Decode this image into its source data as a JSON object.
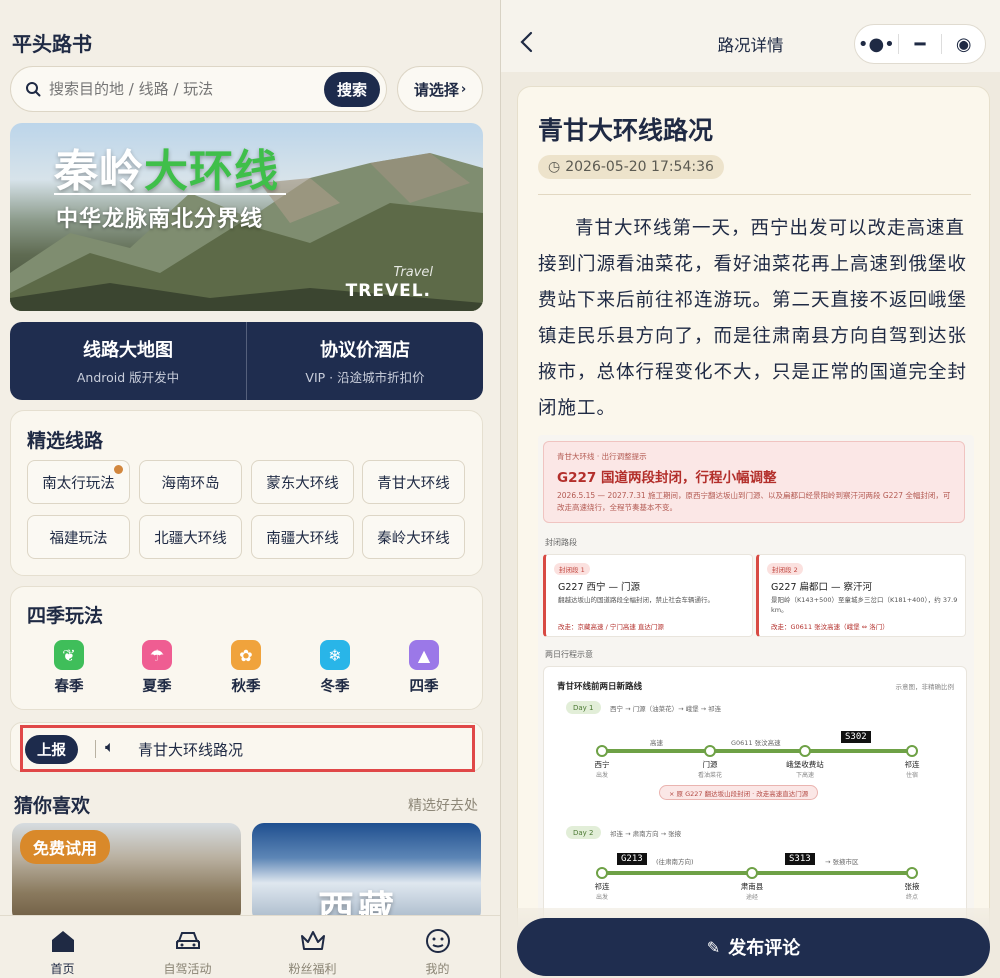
{
  "left": {
    "app_title": "平头路书",
    "search": {
      "placeholder": "搜索目的地 / 线路 / 玩法",
      "button": "搜索"
    },
    "select_label": "请选择",
    "banner": {
      "title_a": "秦岭",
      "title_b": "大环线",
      "subtitle": "中华龙脉南北分界线",
      "tag_script": "Travel",
      "tag_caps": "TREVEL."
    },
    "quick": [
      {
        "title": "线路大地图",
        "sub": "Android 版开发中"
      },
      {
        "title": "协议价酒店",
        "sub": "VIP · 沿途城市折扣价"
      }
    ],
    "routes_title": "精选线路",
    "routes": [
      "南太行玩法",
      "海南环岛",
      "蒙东大环线",
      "青甘大环线",
      "福建玩法",
      "北疆大环线",
      "南疆大环线",
      "秦岭大环线"
    ],
    "seasons_title": "四季玩法",
    "seasons": [
      {
        "label": "春季",
        "icon": "leaf-icon",
        "color": "#3fbe5a"
      },
      {
        "label": "夏季",
        "icon": "palm-icon",
        "color": "#ef5d92"
      },
      {
        "label": "秋季",
        "icon": "maple-icon",
        "color": "#f0a33c"
      },
      {
        "label": "冬季",
        "icon": "snowflake-icon",
        "color": "#29b5e8"
      },
      {
        "label": "四季",
        "icon": "mountain-icon",
        "color": "#9b78e8"
      }
    ],
    "announce": {
      "tag": "上报",
      "text": "青甘大环线路况"
    },
    "guess": {
      "title": "猜你喜欢",
      "more": "精选好去处",
      "badge": "免费试用",
      "card2_title": "西藏"
    },
    "tabs": [
      {
        "label": "首页",
        "icon": "home-icon"
      },
      {
        "label": "自驾活动",
        "icon": "car-icon"
      },
      {
        "label": "粉丝福利",
        "icon": "crown-icon"
      },
      {
        "label": "我的",
        "icon": "profile-icon"
      }
    ]
  },
  "right": {
    "nav_title": "路况详情",
    "article": {
      "title": "青甘大环线路况",
      "time": "2026-05-20 17:54:36",
      "body": "青甘大环线第一天，西宁出发可以改走高速直接到门源看油菜花，看好油菜花再上高速到俄堡收费站下来后前往祁连游玩。第二天直接不返回峨堡镇走民乐县方向了，而是往肃南县方向自驾到达张掖市，总体行程变化不大，只是正常的国道完全封闭施工。"
    },
    "doc": {
      "warn_small": "青甘大环线 · 出行调整提示",
      "warn_title": "G227 国道两段封闭，行程小幅调整",
      "warn_text": "2026.5.15 — 2027.7.31 施工期间，原西宁翻达坂山到门源、以及扁都口经景阳岭到察汗河两段 G227 全幅封闭，可改走高速绕行，全程节奏基本不变。",
      "closed_label": "封闭路段",
      "segments": [
        {
          "tag": "封闭段 1",
          "name": "G227 西宁 — 门源",
          "desc": "翻越达坂山的国道路段全幅封闭，禁止社会车辆通行。",
          "alt": "改走：京藏高速 / 宁门高速 直达门源"
        },
        {
          "tag": "封闭段 2",
          "name": "G227 扁都口 — 察汗河",
          "desc": "景阳岭（K143+500）至童城乡三岔口（K181+400），约 37.9 km。",
          "alt": "改走：G0611 张汶高速（峨堡 ⇔ 洛门）"
        }
      ],
      "plan_label": "两日行程示意",
      "route_title": "青甘环线前两日新路线",
      "route_note": "示意图，非精确比例",
      "day1": {
        "tag": "Day 1",
        "text": "西宁 → 门源（油菜花）→ 峨堡 → 祁连",
        "road_a": "高速",
        "road_b": "G0611 张汶高速",
        "hw": "S302",
        "nodes": [
          {
            "n": "西宁",
            "s": "出发"
          },
          {
            "n": "门源",
            "s": "看油菜花"
          },
          {
            "n": "峨堡收费站",
            "s": "下高速"
          },
          {
            "n": "祁连",
            "s": "住宿"
          }
        ],
        "note": "× 原 G227 翻达坂山段封闭 · 改走高速直达门源"
      },
      "day2": {
        "tag": "Day 2",
        "text": "祁连 → 肃南方向 → 张掖",
        "hw_a": "G213",
        "road_a": "(往肃南方向)",
        "hw_b": "S313",
        "road_b": "→ 张掖市区",
        "nodes": [
          {
            "n": "祁连",
            "s": "出发"
          },
          {
            "n": "肃南县",
            "s": "途经"
          },
          {
            "n": "张掖",
            "s": "终点"
          }
        ]
      }
    },
    "comment_button": "发布评论"
  }
}
